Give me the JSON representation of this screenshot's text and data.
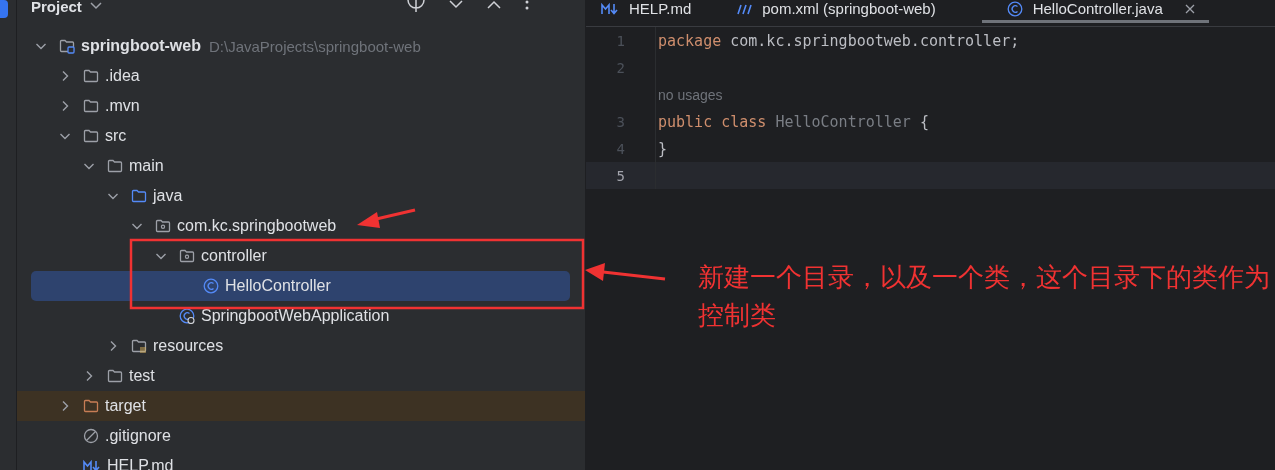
{
  "project_panel": {
    "title": "Project",
    "tree": [
      {
        "label": "springboot-web",
        "hint": "D:\\JavaProjects\\springboot-web",
        "kind": "module",
        "expanded": true,
        "selected": false,
        "children": [
          {
            "label": ".idea",
            "kind": "folder",
            "expanded": false,
            "selected": false
          },
          {
            "label": ".mvn",
            "kind": "folder",
            "expanded": false,
            "selected": false
          },
          {
            "label": "src",
            "kind": "folder",
            "expanded": true,
            "selected": false,
            "children": [
              {
                "label": "main",
                "kind": "folder",
                "expanded": true,
                "selected": false,
                "children": [
                  {
                    "label": "java",
                    "kind": "source-folder",
                    "expanded": true,
                    "selected": false,
                    "children": [
                      {
                        "label": "com.kc.springbootweb",
                        "kind": "package",
                        "expanded": true,
                        "selected": false,
                        "children": [
                          {
                            "label": "controller",
                            "kind": "package",
                            "expanded": true,
                            "selected": false,
                            "children": [
                              {
                                "label": "HelloController",
                                "kind": "class",
                                "selected": true
                              }
                            ]
                          },
                          {
                            "label": "SpringbootWebApplication",
                            "kind": "spring-class",
                            "selected": false
                          }
                        ]
                      }
                    ]
                  },
                  {
                    "label": "resources",
                    "kind": "resources-folder",
                    "expanded": false,
                    "selected": false
                  }
                ]
              },
              {
                "label": "test",
                "kind": "folder",
                "expanded": false,
                "selected": false
              }
            ]
          },
          {
            "label": "target",
            "kind": "excluded-folder",
            "expanded": false,
            "selected": false
          },
          {
            "label": ".gitignore",
            "kind": "ignore-file",
            "selected": false
          },
          {
            "label": "HELP.md",
            "kind": "markdown",
            "selected": false
          }
        ]
      }
    ]
  },
  "editor": {
    "tabs": [
      {
        "label": "HELP.md",
        "kind": "markdown",
        "selected": false
      },
      {
        "label": "pom.xml (springboot-web)",
        "kind": "maven",
        "selected": false
      },
      {
        "label": "HelloController.java",
        "kind": "class",
        "selected": true
      }
    ],
    "lines": [
      {
        "kind": "code",
        "number": "1",
        "current": false,
        "tokens": [
          {
            "kind": "keyword",
            "text": "package"
          },
          {
            "kind": "plain",
            "text": " com.kc.springbootweb.controller;"
          }
        ]
      },
      {
        "kind": "code",
        "number": "2",
        "current": false
      },
      {
        "kind": "inlay",
        "text": "no usages"
      },
      {
        "kind": "code",
        "number": "3",
        "current": false,
        "tokens": [
          {
            "kind": "keyword",
            "text": "public class "
          },
          {
            "kind": "unused",
            "text": "HelloController"
          },
          {
            "kind": "plain",
            "text": " {"
          }
        ]
      },
      {
        "kind": "code",
        "number": "4",
        "current": false,
        "tokens": [
          {
            "kind": "plain",
            "text": "}"
          }
        ]
      },
      {
        "kind": "code",
        "number": "5",
        "current": true
      }
    ]
  },
  "annotation": {
    "note": "新建一个目录，以及一个类，这个目录下的类作为控制类"
  }
}
